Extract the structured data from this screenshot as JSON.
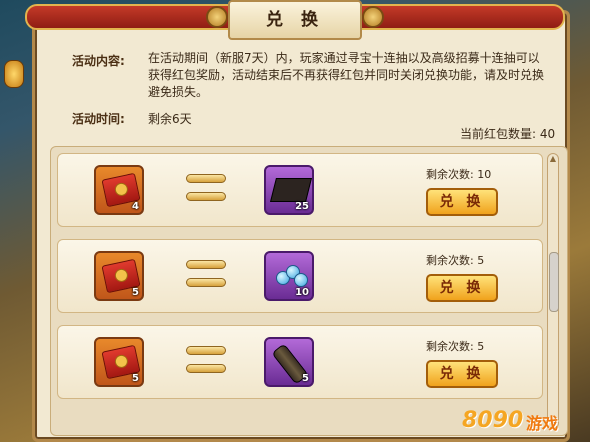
{
  "window": {
    "title": "兑 换"
  },
  "activity": {
    "content_label": "活动内容:",
    "content_text": "在活动期间（新服7天）内，玩家通过寻宝十连抽以及高级招募十连抽可以获得红包奖励，活动结束后不再获得红包并同时关闭兑换功能，请及时兑换避免损失。",
    "time_label": "活动时间:",
    "time_value": "剩余6天",
    "redpack_count_text": "当前红包数量: 40"
  },
  "exchange_rows": [
    {
      "cost_qty": "4",
      "reward_item": "dark-tome-icon",
      "reward_qty": "25",
      "remaining_text": "剩余次数: 10",
      "button_label": "兑 换"
    },
    {
      "cost_qty": "5",
      "reward_item": "blue-orbs-icon",
      "reward_qty": "10",
      "remaining_text": "剩余次数: 5",
      "button_label": "兑 换"
    },
    {
      "cost_qty": "5",
      "reward_item": "telescope-icon",
      "reward_qty": "5",
      "remaining_text": "剩余次数: 5",
      "button_label": "兑 换"
    }
  ],
  "watermark": {
    "number": "8090",
    "text": "游戏"
  },
  "colors": {
    "accent_red": "#c43a28",
    "button_gold": "#f0a21c",
    "panel_bg": "#f2e9d2",
    "slot_purple": "#8a44b8"
  }
}
